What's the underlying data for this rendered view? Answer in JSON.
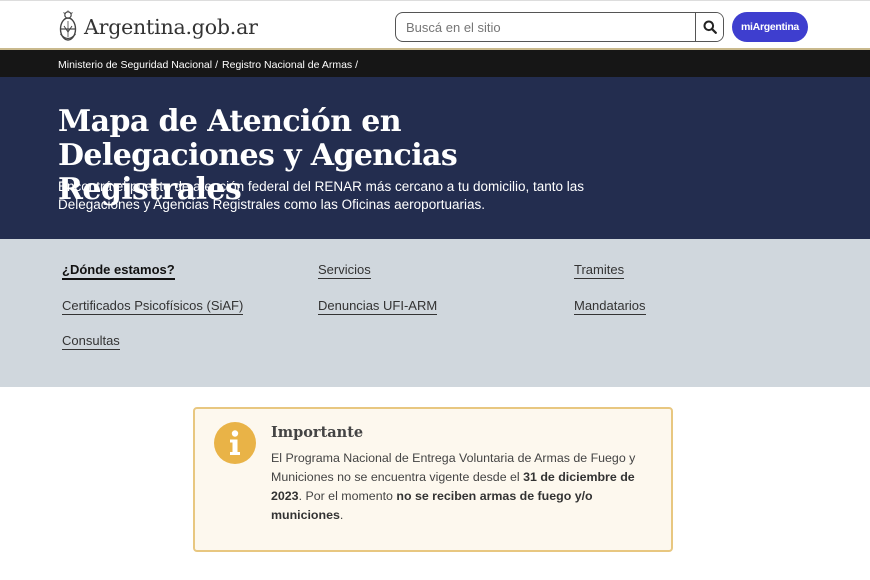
{
  "header": {
    "site_name": "Argentina.gob.ar",
    "logo_icon": "argentina-coat-of-arms",
    "search_placeholder": "Buscá en el sitio",
    "search_icon": "search-icon",
    "account_button_label": "miArgentina",
    "accent_color": "#3e3ecf"
  },
  "breadcrumb": {
    "items": [
      {
        "label": "Ministerio de Seguridad Nacional"
      },
      {
        "label": "Registro Nacional de Armas"
      }
    ],
    "separator": "/"
  },
  "hero": {
    "title": "Mapa de Atención en Delegaciones y Agencias Registrales",
    "subtitle": "Encontrá el puesto de atención federal del RENAR más cercano a tu domicilio, tanto las Delegaciones y Agencias Registrales como las Oficinas aeroportuarias.",
    "background_color": "#232d4f"
  },
  "nav_links": [
    {
      "label": "¿Dónde estamos?",
      "active": true
    },
    {
      "label": "Servicios",
      "active": false
    },
    {
      "label": "Tramites",
      "active": false
    },
    {
      "label": "Certificados Psicofísicos (SiAF)",
      "active": false
    },
    {
      "label": "Denuncias UFI-ARM",
      "active": false
    },
    {
      "label": "Mandatarios",
      "active": false
    },
    {
      "label": "Consultas",
      "active": false
    }
  ],
  "alert": {
    "icon": "info-icon",
    "title": "Importante",
    "text_1": "El Programa Nacional de Entrega Voluntaria de Armas de Fuego y Municiones no se encuentra vigente desde el ",
    "bold_1": "31 de diciembre de 2023",
    "text_2": ". Por el momento ",
    "bold_2": "no se reciben armas de fuego y/o municiones",
    "text_3": ".",
    "border_color": "#e8c780",
    "icon_color": "#e9b347"
  }
}
